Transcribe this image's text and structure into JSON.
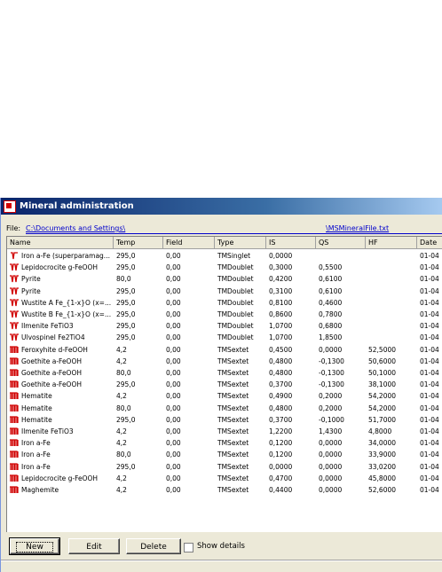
{
  "window": {
    "title": "Mineral administration"
  },
  "file": {
    "label": "File:",
    "path_prefix": "C:\\Documents and Settings\\",
    "path_suffix": "\\MSMineralFile.txt"
  },
  "columns": [
    "Name",
    "Temp",
    "Field",
    "Type",
    "IS",
    "QS",
    "HF",
    "Date"
  ],
  "rows": [
    {
      "icon": "singlet-icon",
      "name": "Iron a-Fe (superparamag...",
      "temp": "295,0",
      "field": "0,00",
      "type": "TMSinglet",
      "is": "0,0000",
      "qs": "",
      "hf": "",
      "date": "01-04"
    },
    {
      "icon": "doublet-icon",
      "name": "Lepidocrocite g-FeOOH",
      "temp": "295,0",
      "field": "0,00",
      "type": "TMDoublet",
      "is": "0,3000",
      "qs": "0,5500",
      "hf": "",
      "date": "01-04"
    },
    {
      "icon": "doublet-icon",
      "name": "Pyrite",
      "temp": "80,0",
      "field": "0,00",
      "type": "TMDoublet",
      "is": "0,4200",
      "qs": "0,6100",
      "hf": "",
      "date": "01-04"
    },
    {
      "icon": "doublet-icon",
      "name": "Pyrite",
      "temp": "295,0",
      "field": "0,00",
      "type": "TMDoublet",
      "is": "0,3100",
      "qs": "0,6100",
      "hf": "",
      "date": "01-04"
    },
    {
      "icon": "doublet-icon",
      "name": "Wustite A Fe_{1-x}O (x=...",
      "temp": "295,0",
      "field": "0,00",
      "type": "TMDoublet",
      "is": "0,8100",
      "qs": "0,4600",
      "hf": "",
      "date": "01-04"
    },
    {
      "icon": "doublet-icon",
      "name": "Wustite B Fe_{1-x}O (x=...",
      "temp": "295,0",
      "field": "0,00",
      "type": "TMDoublet",
      "is": "0,8600",
      "qs": "0,7800",
      "hf": "",
      "date": "01-04"
    },
    {
      "icon": "doublet-icon",
      "name": "Ilmenite FeTiO3",
      "temp": "295,0",
      "field": "0,00",
      "type": "TMDoublet",
      "is": "1,0700",
      "qs": "0,6800",
      "hf": "",
      "date": "01-04"
    },
    {
      "icon": "doublet-icon",
      "name": "Ulvospinel Fe2TiO4",
      "temp": "295,0",
      "field": "0,00",
      "type": "TMDoublet",
      "is": "1,0700",
      "qs": "1,8500",
      "hf": "",
      "date": "01-04"
    },
    {
      "icon": "sextet-icon",
      "name": "Feroxyhite d-FeOOH",
      "temp": "4,2",
      "field": "0,00",
      "type": "TMSextet",
      "is": "0,4500",
      "qs": "0,0000",
      "hf": "52,5000",
      "date": "01-04"
    },
    {
      "icon": "sextet-icon",
      "name": "Goethite a-FeOOH",
      "temp": "4,2",
      "field": "0,00",
      "type": "TMSextet",
      "is": "0,4800",
      "qs": "-0,1300",
      "hf": "50,6000",
      "date": "01-04"
    },
    {
      "icon": "sextet-icon",
      "name": "Goethite a-FeOOH",
      "temp": "80,0",
      "field": "0,00",
      "type": "TMSextet",
      "is": "0,4800",
      "qs": "-0,1300",
      "hf": "50,1000",
      "date": "01-04"
    },
    {
      "icon": "sextet-icon",
      "name": "Goethite a-FeOOH",
      "temp": "295,0",
      "field": "0,00",
      "type": "TMSextet",
      "is": "0,3700",
      "qs": "-0,1300",
      "hf": "38,1000",
      "date": "01-04"
    },
    {
      "icon": "sextet-icon",
      "name": "Hematite",
      "temp": "4,2",
      "field": "0,00",
      "type": "TMSextet",
      "is": "0,4900",
      "qs": "0,2000",
      "hf": "54,2000",
      "date": "01-04"
    },
    {
      "icon": "sextet-icon",
      "name": "Hematite",
      "temp": "80,0",
      "field": "0,00",
      "type": "TMSextet",
      "is": "0,4800",
      "qs": "0,2000",
      "hf": "54,2000",
      "date": "01-04"
    },
    {
      "icon": "sextet-icon",
      "name": "Hematite",
      "temp": "295,0",
      "field": "0,00",
      "type": "TMSextet",
      "is": "0,3700",
      "qs": "-0,1000",
      "hf": "51,7000",
      "date": "01-04"
    },
    {
      "icon": "sextet-icon",
      "name": "Ilmenite FeTiO3",
      "temp": "4,2",
      "field": "0,00",
      "type": "TMSextet",
      "is": "1,2200",
      "qs": "1,4300",
      "hf": "4,8000",
      "date": "01-04"
    },
    {
      "icon": "sextet-icon",
      "name": "Iron a-Fe",
      "temp": "4,2",
      "field": "0,00",
      "type": "TMSextet",
      "is": "0,1200",
      "qs": "0,0000",
      "hf": "34,0000",
      "date": "01-04"
    },
    {
      "icon": "sextet-icon",
      "name": "Iron a-Fe",
      "temp": "80,0",
      "field": "0,00",
      "type": "TMSextet",
      "is": "0,1200",
      "qs": "0,0000",
      "hf": "33,9000",
      "date": "01-04"
    },
    {
      "icon": "sextet-icon",
      "name": "Iron a-Fe",
      "temp": "295,0",
      "field": "0,00",
      "type": "TMSextet",
      "is": "0,0000",
      "qs": "0,0000",
      "hf": "33,0200",
      "date": "01-04"
    },
    {
      "icon": "sextet-icon",
      "name": "Lepidocrocite g-FeOOH",
      "temp": "4,2",
      "field": "0,00",
      "type": "TMSextet",
      "is": "0,4700",
      "qs": "0,0000",
      "hf": "45,8000",
      "date": "01-04"
    },
    {
      "icon": "sextet-icon",
      "name": "Maghemite",
      "temp": "4,2",
      "field": "0,00",
      "type": "TMSextet",
      "is": "0,4400",
      "qs": "0,0000",
      "hf": "52,6000",
      "date": "01-04"
    }
  ],
  "buttons": {
    "new": "New",
    "edit": "Edit",
    "delete": "Delete"
  },
  "show_details": {
    "label": "Show details",
    "checked": false
  },
  "colors": {
    "icon_red": "#d00000",
    "link_blue": "#0000cc"
  }
}
